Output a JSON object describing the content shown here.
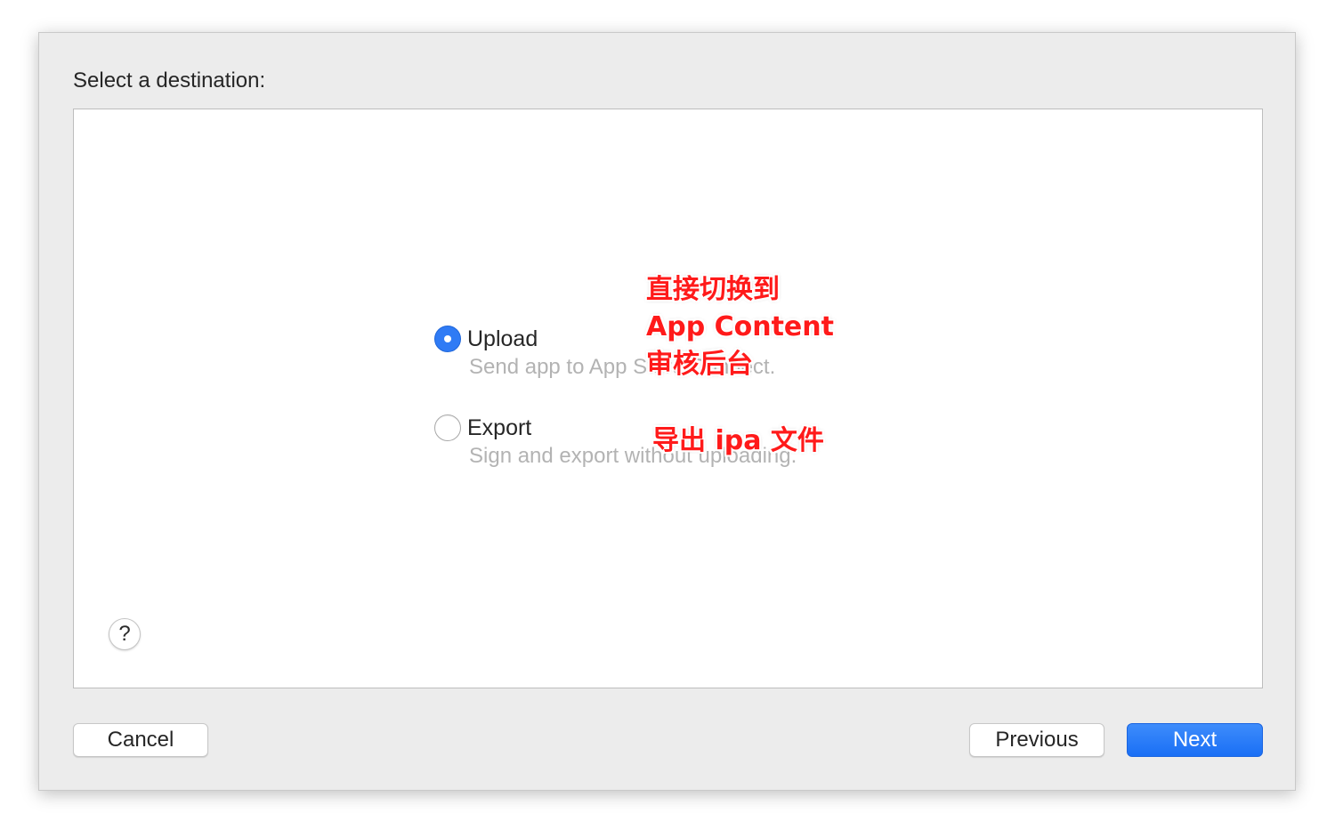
{
  "dialog": {
    "heading": "Select a destination:"
  },
  "options": [
    {
      "title": "Upload",
      "description": "Send app to App Store Connect.",
      "selected": true
    },
    {
      "title": "Export",
      "description": "Sign and export without uploading.",
      "selected": false
    }
  ],
  "annotations": {
    "upload_note_line1": "直接切换到",
    "upload_note_line2": "App Content",
    "upload_note_line3": "审核后台",
    "export_note": "导出 ipa 文件",
    "color": "#ff1a1a"
  },
  "help": {
    "label": "?"
  },
  "buttons": {
    "cancel": "Cancel",
    "previous": "Previous",
    "next": "Next"
  },
  "colors": {
    "accent": "#2f7bf5",
    "sheet_background": "#ececec",
    "content_background": "#ffffff"
  }
}
